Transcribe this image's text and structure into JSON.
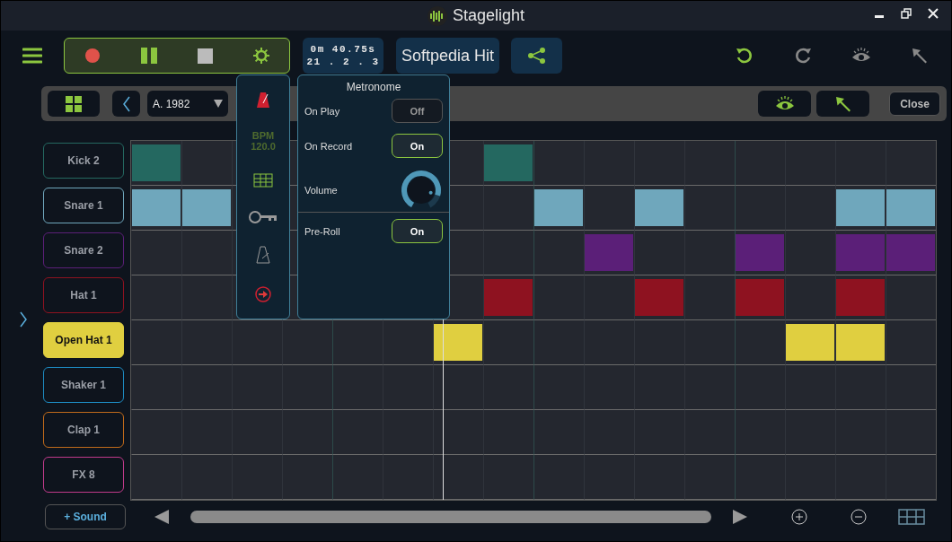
{
  "window": {
    "title": "Stagelight"
  },
  "transport": {
    "time": "0m 40.75s",
    "position": "21 . 2 . 3"
  },
  "song": {
    "title": "Softpedia Hit"
  },
  "pattern_bar": {
    "pattern": "A. 1982",
    "close": "Close"
  },
  "metronome": {
    "bpm_label": "BPM",
    "bpm": "120.0",
    "title": "Metronome",
    "sections": [
      [
        {
          "kind": "toggle",
          "label": "On Play",
          "value": "Off",
          "on": false
        },
        {
          "kind": "toggle",
          "label": "On Record",
          "value": "On",
          "on": true
        },
        {
          "kind": "knob",
          "label": "Volume",
          "level": 0.85
        }
      ],
      [
        {
          "kind": "toggle",
          "label": "Pre-Roll",
          "value": "On",
          "on": true
        }
      ]
    ]
  },
  "tracks": [
    {
      "name": "Kick 2",
      "color": "#246860",
      "selected": false,
      "steps": [
        {
          "kind": "step",
          "on": true
        },
        {
          "kind": "step",
          "on": false
        },
        {
          "kind": "covered"
        },
        {
          "kind": "covered"
        },
        {
          "kind": "hidden"
        },
        {
          "kind": "hidden"
        },
        {
          "kind": "step",
          "on": false
        },
        {
          "kind": "step",
          "on": true
        },
        {
          "kind": "step",
          "on": false
        },
        {
          "kind": "step",
          "on": false
        },
        {
          "kind": "step",
          "on": false
        },
        {
          "kind": "step",
          "on": false
        },
        {
          "kind": "step",
          "on": false
        },
        {
          "kind": "step",
          "on": false
        },
        {
          "kind": "step",
          "on": false
        },
        {
          "kind": "step",
          "on": false
        }
      ]
    },
    {
      "name": "Snare 1",
      "color": "#6fa7bc",
      "selected": false,
      "steps": [
        {
          "kind": "step",
          "on": true
        },
        {
          "kind": "step",
          "on": true
        },
        {
          "kind": "covered"
        },
        {
          "kind": "covered"
        },
        {
          "kind": "hidden"
        },
        {
          "kind": "hidden"
        },
        {
          "kind": "step",
          "on": false
        },
        {
          "kind": "step",
          "on": false
        },
        {
          "kind": "step",
          "on": true
        },
        {
          "kind": "step",
          "on": false
        },
        {
          "kind": "step",
          "on": true
        },
        {
          "kind": "step",
          "on": false
        },
        {
          "kind": "step",
          "on": false
        },
        {
          "kind": "step",
          "on": false
        },
        {
          "kind": "step",
          "on": true
        },
        {
          "kind": "step",
          "on": true
        }
      ]
    },
    {
      "name": "Snare 2",
      "color": "#5b1f78",
      "selected": false,
      "steps": [
        {
          "kind": "step",
          "on": false
        },
        {
          "kind": "step",
          "on": false
        },
        {
          "kind": "covered"
        },
        {
          "kind": "covered"
        },
        {
          "kind": "hidden"
        },
        {
          "kind": "hidden"
        },
        {
          "kind": "step",
          "on": false
        },
        {
          "kind": "step",
          "on": false
        },
        {
          "kind": "step",
          "on": false
        },
        {
          "kind": "step",
          "on": true
        },
        {
          "kind": "step",
          "on": false
        },
        {
          "kind": "step",
          "on": false
        },
        {
          "kind": "step",
          "on": true
        },
        {
          "kind": "step",
          "on": false
        },
        {
          "kind": "step",
          "on": true
        },
        {
          "kind": "step",
          "on": true
        }
      ]
    },
    {
      "name": "Hat 1",
      "color": "#8e1220",
      "selected": false,
      "steps": [
        {
          "kind": "step",
          "on": false
        },
        {
          "kind": "step",
          "on": false
        },
        {
          "kind": "covered"
        },
        {
          "kind": "covered"
        },
        {
          "kind": "hidden"
        },
        {
          "kind": "hidden"
        },
        {
          "kind": "step",
          "on": false
        },
        {
          "kind": "step",
          "on": true
        },
        {
          "kind": "step",
          "on": false
        },
        {
          "kind": "step",
          "on": false
        },
        {
          "kind": "step",
          "on": true
        },
        {
          "kind": "step",
          "on": false
        },
        {
          "kind": "step",
          "on": true
        },
        {
          "kind": "step",
          "on": false
        },
        {
          "kind": "step",
          "on": true
        },
        {
          "kind": "step",
          "on": false
        }
      ]
    },
    {
      "name": "Open Hat 1",
      "color": "#e0cf40",
      "selected": true,
      "steps": [
        {
          "kind": "step",
          "on": false
        },
        {
          "kind": "step",
          "on": false
        },
        {
          "kind": "step",
          "on": false
        },
        {
          "kind": "step",
          "on": false
        },
        {
          "kind": "step",
          "on": false
        },
        {
          "kind": "step",
          "on": false
        },
        {
          "kind": "step",
          "on": true
        },
        {
          "kind": "step",
          "on": false
        },
        {
          "kind": "step",
          "on": false
        },
        {
          "kind": "step",
          "on": false
        },
        {
          "kind": "step",
          "on": false
        },
        {
          "kind": "step",
          "on": false
        },
        {
          "kind": "step",
          "on": false
        },
        {
          "kind": "step",
          "on": true
        },
        {
          "kind": "step",
          "on": true
        },
        {
          "kind": "step",
          "on": false
        }
      ]
    },
    {
      "name": "Shaker 1",
      "color": "#1d8ac0",
      "selected": false,
      "steps": [
        {
          "kind": "step",
          "on": false
        },
        {
          "kind": "step",
          "on": false
        },
        {
          "kind": "step",
          "on": false
        },
        {
          "kind": "step",
          "on": false
        },
        {
          "kind": "step",
          "on": false
        },
        {
          "kind": "step",
          "on": false
        },
        {
          "kind": "step",
          "on": false
        },
        {
          "kind": "step",
          "on": false
        },
        {
          "kind": "step",
          "on": false
        },
        {
          "kind": "step",
          "on": false
        },
        {
          "kind": "step",
          "on": false
        },
        {
          "kind": "step",
          "on": false
        },
        {
          "kind": "step",
          "on": false
        },
        {
          "kind": "step",
          "on": false
        },
        {
          "kind": "step",
          "on": false
        },
        {
          "kind": "step",
          "on": false
        }
      ]
    },
    {
      "name": "Clap 1",
      "color": "#c06a1a",
      "selected": false,
      "steps": [
        {
          "kind": "step",
          "on": false
        },
        {
          "kind": "step",
          "on": false
        },
        {
          "kind": "step",
          "on": false
        },
        {
          "kind": "step",
          "on": false
        },
        {
          "kind": "step",
          "on": false
        },
        {
          "kind": "step",
          "on": false
        },
        {
          "kind": "step",
          "on": false
        },
        {
          "kind": "step",
          "on": false
        },
        {
          "kind": "step",
          "on": false
        },
        {
          "kind": "step",
          "on": false
        },
        {
          "kind": "step",
          "on": false
        },
        {
          "kind": "step",
          "on": false
        },
        {
          "kind": "step",
          "on": false
        },
        {
          "kind": "step",
          "on": false
        },
        {
          "kind": "step",
          "on": false
        },
        {
          "kind": "step",
          "on": false
        }
      ]
    },
    {
      "name": "FX 8",
      "color": "#c03a8a",
      "selected": false,
      "steps": [
        {
          "kind": "step",
          "on": false
        },
        {
          "kind": "step",
          "on": false
        },
        {
          "kind": "step",
          "on": false
        },
        {
          "kind": "step",
          "on": false
        },
        {
          "kind": "step",
          "on": false
        },
        {
          "kind": "step",
          "on": false
        },
        {
          "kind": "step",
          "on": false
        },
        {
          "kind": "step",
          "on": false
        },
        {
          "kind": "step",
          "on": false
        },
        {
          "kind": "step",
          "on": false
        },
        {
          "kind": "step",
          "on": false
        },
        {
          "kind": "step",
          "on": false
        },
        {
          "kind": "step",
          "on": false
        },
        {
          "kind": "step",
          "on": false
        },
        {
          "kind": "step",
          "on": false
        },
        {
          "kind": "step",
          "on": false
        }
      ]
    }
  ],
  "add_sound": "+ Sound"
}
